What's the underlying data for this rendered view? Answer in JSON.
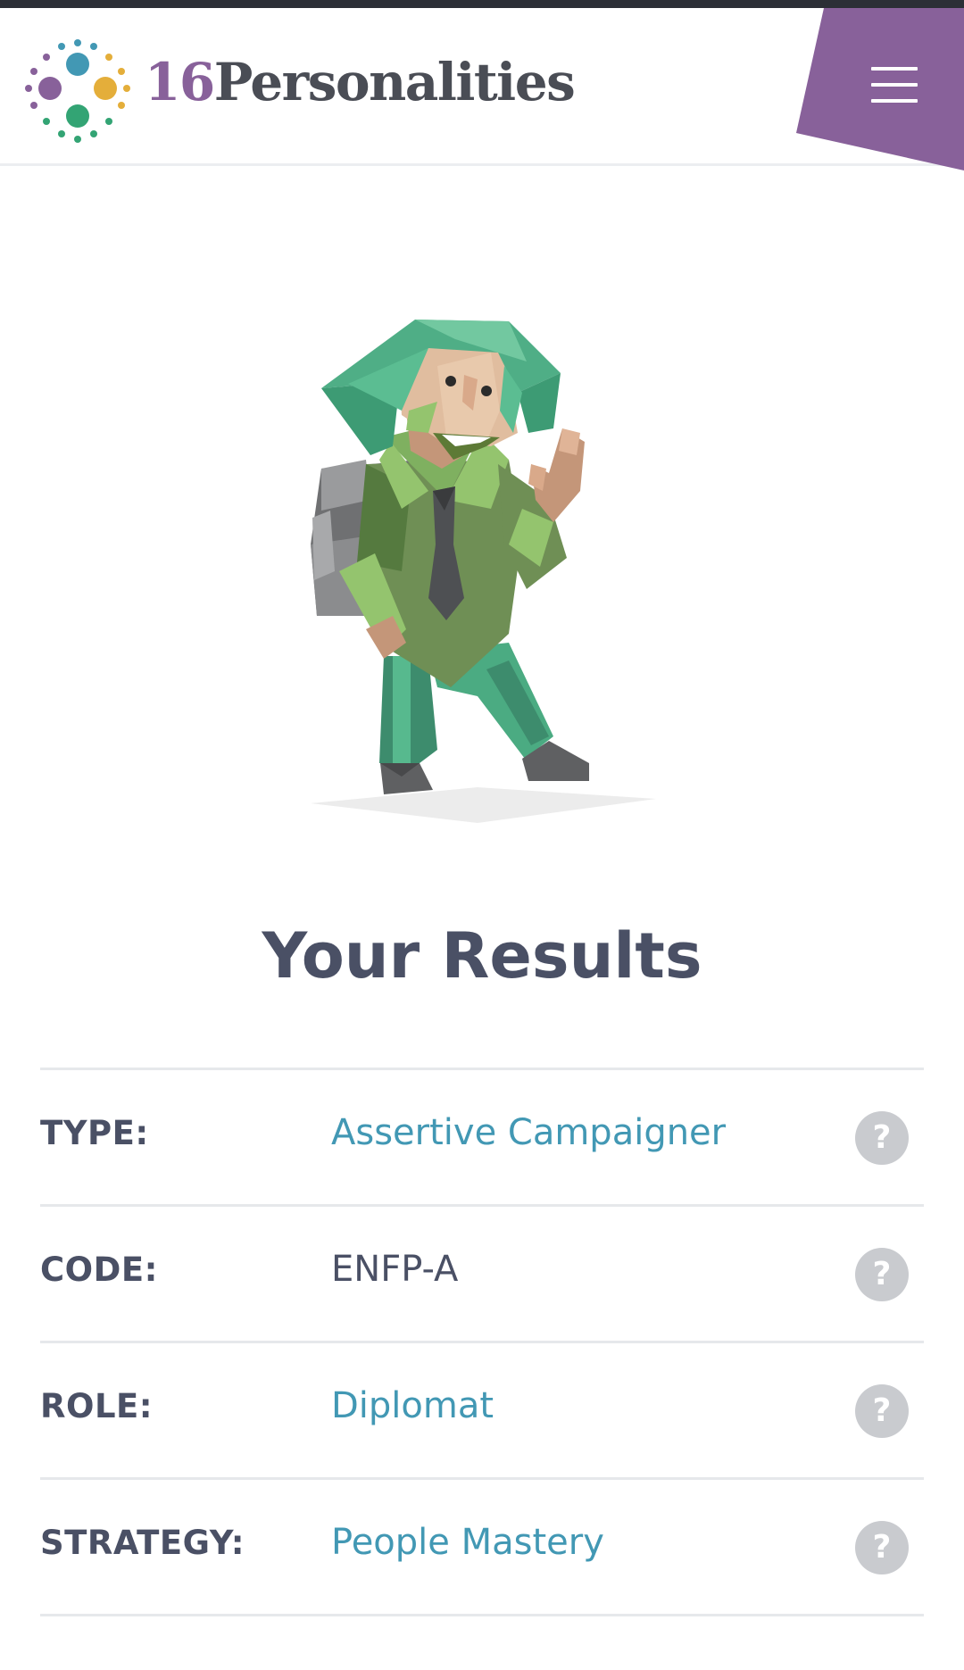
{
  "brand": {
    "number": "16",
    "word": "Personalities",
    "colors": {
      "purple": "#88619a",
      "teal": "#4298b4",
      "green": "#33a474",
      "yellow": "#e4ae3a",
      "dark": "#4a4d55"
    }
  },
  "header": {
    "menu_icon": "hamburger-menu-icon",
    "menu_flag_color": "#88619a"
  },
  "hero": {
    "illustration": "campaigner-character-illustration"
  },
  "results": {
    "title": "Your Results",
    "rows": [
      {
        "label": "TYPE:",
        "value": "Assertive Campaigner",
        "help": "?"
      },
      {
        "label": "CODE:",
        "value": "ENFP-A",
        "help": "?"
      },
      {
        "label": "ROLE:",
        "value": "Diplomat",
        "help": "?"
      },
      {
        "label": "STRATEGY:",
        "value": "People Mastery",
        "help": "?"
      }
    ]
  }
}
